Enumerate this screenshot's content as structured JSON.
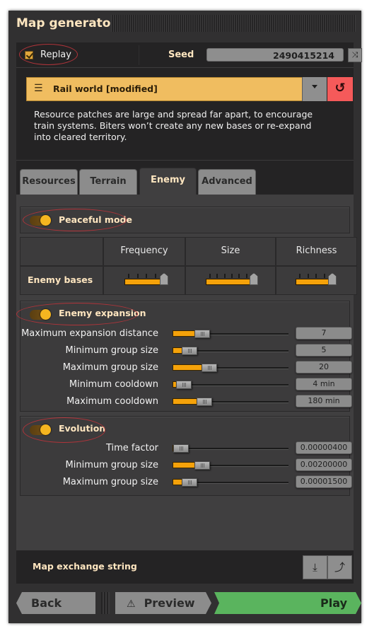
{
  "window": {
    "title": "Map generator"
  },
  "seed_row": {
    "replay_label": "Replay",
    "replay_checked": true,
    "seed_label": "Seed",
    "seed_value": "2490415214",
    "shuffle_icon": "shuffle-icon"
  },
  "preset": {
    "icon": "sliders-icon",
    "label": "Rail world [modified]",
    "dropdown_icon": "caret-down-icon",
    "reset_icon": "reset-icon",
    "description": "Resource patches are large and spread far apart, to encourage train systems. Biters won’t create any new bases or re-expand into cleared territory."
  },
  "tabs": [
    {
      "label": "Resources",
      "active": false
    },
    {
      "label": "Terrain",
      "active": false
    },
    {
      "label": "Enemy",
      "active": true
    },
    {
      "label": "Advanced",
      "active": false
    }
  ],
  "peaceful_mode": {
    "label": "Peaceful mode",
    "enabled": true
  },
  "enemy_bases": {
    "headers": [
      "Frequency",
      "Size",
      "Richness"
    ],
    "row_label": "Enemy bases",
    "sliders": [
      {
        "name": "Frequency",
        "stops": 5,
        "value_index": 4
      },
      {
        "name": "Size",
        "stops": 7,
        "value_index": 6
      },
      {
        "name": "Richness",
        "stops": 5,
        "value_index": 4
      }
    ]
  },
  "enemy_expansion": {
    "label": "Enemy expansion",
    "enabled": true,
    "rows": [
      {
        "label": "Maximum expansion distance",
        "value": "7",
        "fraction": 0.2
      },
      {
        "label": "Minimum group size",
        "value": "5",
        "fraction": 0.09
      },
      {
        "label": "Maximum group size",
        "value": "20",
        "fraction": 0.26
      },
      {
        "label": "Minimum cooldown",
        "value": "4 min",
        "fraction": 0.04
      },
      {
        "label": "Maximum cooldown",
        "value": "180 min",
        "fraction": 0.22
      }
    ]
  },
  "evolution": {
    "label": "Evolution",
    "enabled": true,
    "rows": [
      {
        "label": "Time factor",
        "value": "0.00000400",
        "fraction": 0.02
      },
      {
        "label": "Minimum group size",
        "value": "0.00200000",
        "fraction": 0.2
      },
      {
        "label": "Maximum group size",
        "value": "0.00001500",
        "fraction": 0.09
      }
    ]
  },
  "exchange": {
    "label": "Map exchange string",
    "import_icon": "import-icon",
    "export_icon": "export-icon"
  },
  "footer": {
    "back_label": "Back",
    "preview_label": "Preview",
    "preview_icon": "warning-icon",
    "play_label": "Play"
  },
  "colors": {
    "accent_orange": "#f5a20a",
    "preset_bg": "#f0bd60",
    "reset_red": "#f55a5a",
    "play_green": "#5ab45e",
    "heading_text": "#ffe6c0",
    "annotation_ring": "#b0343a"
  }
}
